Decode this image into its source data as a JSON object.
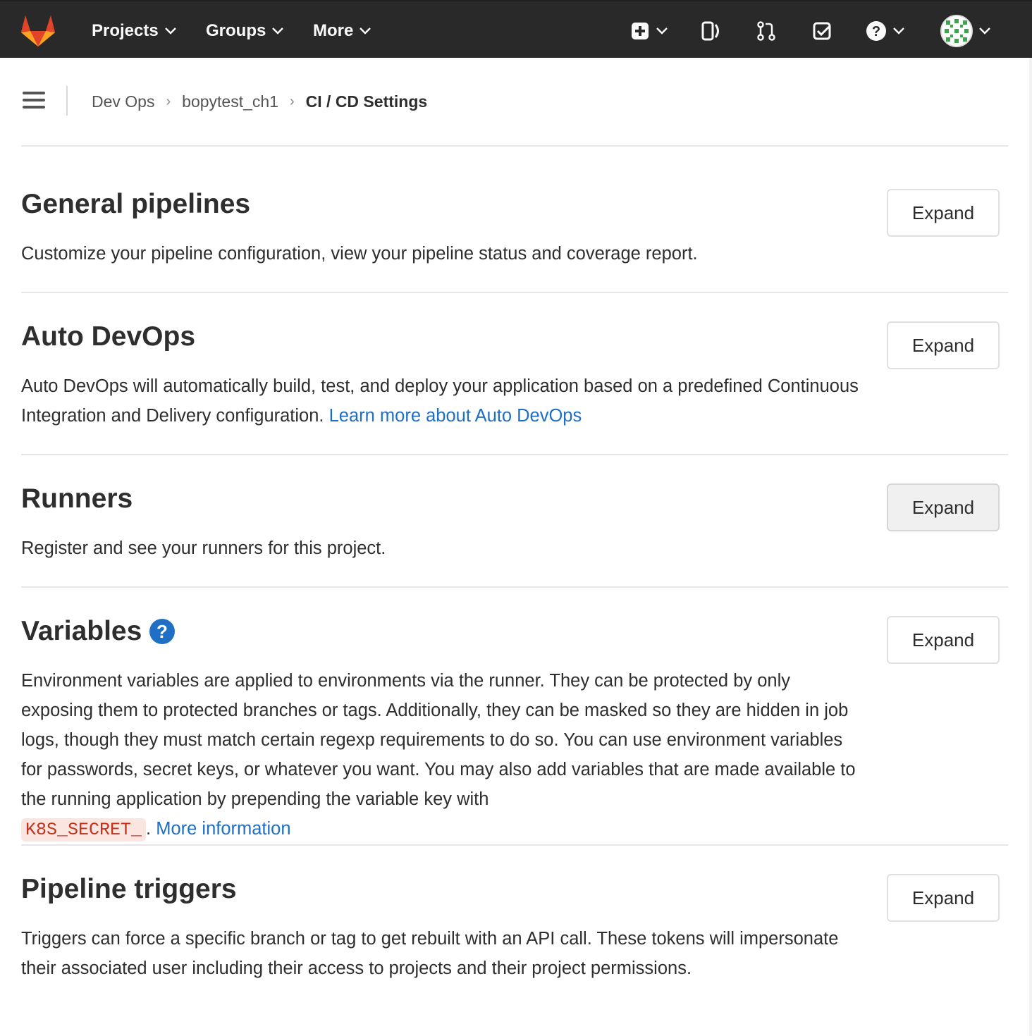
{
  "topbar": {
    "nav": [
      {
        "label": "Projects"
      },
      {
        "label": "Groups"
      },
      {
        "label": "More"
      }
    ],
    "icons": [
      "plus-square-icon",
      "issues-icon",
      "merge-request-icon",
      "todo-check-icon",
      "help-icon",
      "avatar"
    ]
  },
  "breadcrumb": {
    "items": [
      "Dev Ops",
      "bopytest_ch1"
    ],
    "current": "CI / CD Settings"
  },
  "sections": [
    {
      "title": "General pipelines",
      "description": "Customize your pipeline configuration, view your pipeline status and coverage report.",
      "button": "Expand"
    },
    {
      "title": "Auto DevOps",
      "description": "Auto DevOps will automatically build, test, and deploy your application based on a predefined Continuous Integration and Delivery configuration.",
      "link": "Learn more about Auto DevOps",
      "button": "Expand"
    },
    {
      "title": "Runners",
      "description": "Register and see your runners for this project.",
      "button": "Expand"
    },
    {
      "title": "Variables",
      "description": "Environment variables are applied to environments via the runner. They can be protected by only exposing them to protected branches or tags. Additionally, they can be masked so they are hidden in job logs, though they must match certain regexp requirements to do so. You can use environment variables for passwords, secret keys, or whatever you want. You may also add variables that are made available to the running application by prepending the variable key with",
      "code": "K8S_SECRET_",
      "after_code": ".",
      "link": "More information",
      "button": "Expand"
    },
    {
      "title": "Pipeline triggers",
      "description": "Triggers can force a specific branch or tag to get rebuilt with an API call. These tokens will impersonate their associated user including their access to projects and their project permissions.",
      "button": "Expand"
    }
  ],
  "colors": {
    "topbar": "#292929",
    "link": "#1f6fc5",
    "code_bg": "#fbe5e1",
    "code_text": "#c0341d",
    "logo_orange": "#fc6d26"
  }
}
